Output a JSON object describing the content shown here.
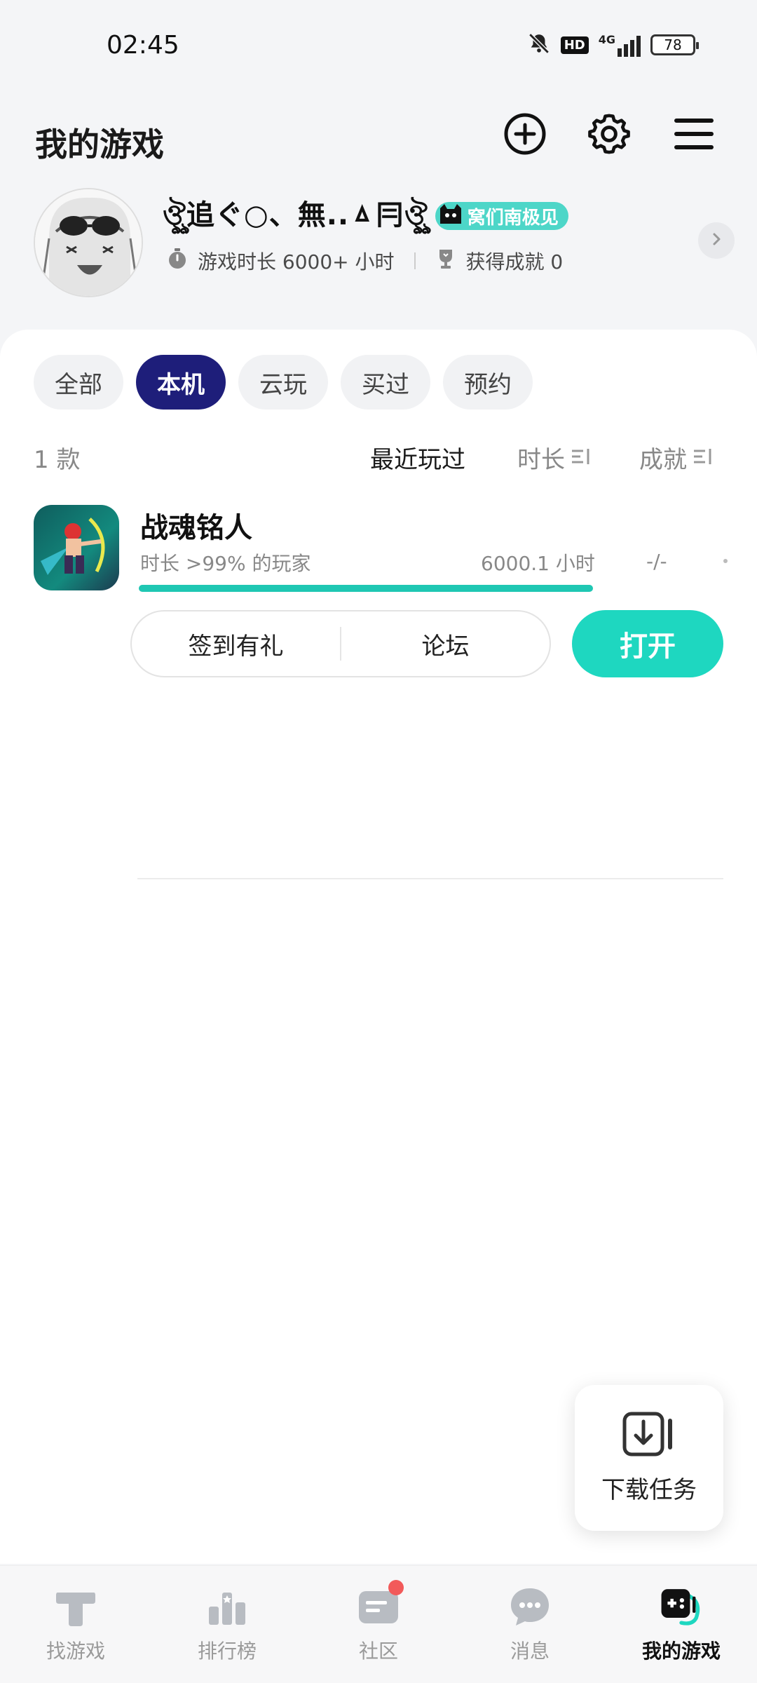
{
  "status_bar": {
    "time": "02:45",
    "hd_label": "HD",
    "network_label": "4G",
    "battery": "78"
  },
  "header": {
    "title": "我的游戏",
    "icons": [
      "add-circle-icon",
      "settings-icon",
      "menu-icon"
    ]
  },
  "profile": {
    "nickname": "ঔৣ追ぐ○、無..ㅿ冃ঔৣ",
    "badge_label": "窝们南极见",
    "playtime_label": "游戏时长 6000+ 小时",
    "achievement_label": "获得成就 0"
  },
  "filters": {
    "tabs": [
      {
        "label": "全部",
        "active": false
      },
      {
        "label": "本机",
        "active": true
      },
      {
        "label": "云玩",
        "active": false
      },
      {
        "label": "买过",
        "active": false
      },
      {
        "label": "预约",
        "active": false
      }
    ]
  },
  "sort": {
    "count": "1 款",
    "recent": "最近玩过",
    "duration": "时长",
    "achievement": "成就"
  },
  "games": [
    {
      "name": "战魂铭人",
      "rank": "时长 >99% 的玩家",
      "hours": "6000.1 小时",
      "achievement": "-/-",
      "progress": 1.0,
      "actions": {
        "checkin": "签到有礼",
        "forum": "论坛",
        "open": "打开"
      }
    }
  ],
  "download_fab": {
    "label": "下载任务"
  },
  "bottom_nav": {
    "items": [
      {
        "label": "找游戏",
        "icon": "find-game-icon",
        "active": false
      },
      {
        "label": "排行榜",
        "icon": "leaderboard-icon",
        "active": false
      },
      {
        "label": "社区",
        "icon": "community-icon",
        "active": false,
        "dot": true
      },
      {
        "label": "消息",
        "icon": "message-icon",
        "active": false
      },
      {
        "label": "我的游戏",
        "icon": "my-games-icon",
        "active": true
      }
    ]
  },
  "colors": {
    "accent": "#1ed7c0",
    "active_chip": "#1e1e7a",
    "badge": "#4dd6c8",
    "notification_dot": "#f25a5a"
  }
}
